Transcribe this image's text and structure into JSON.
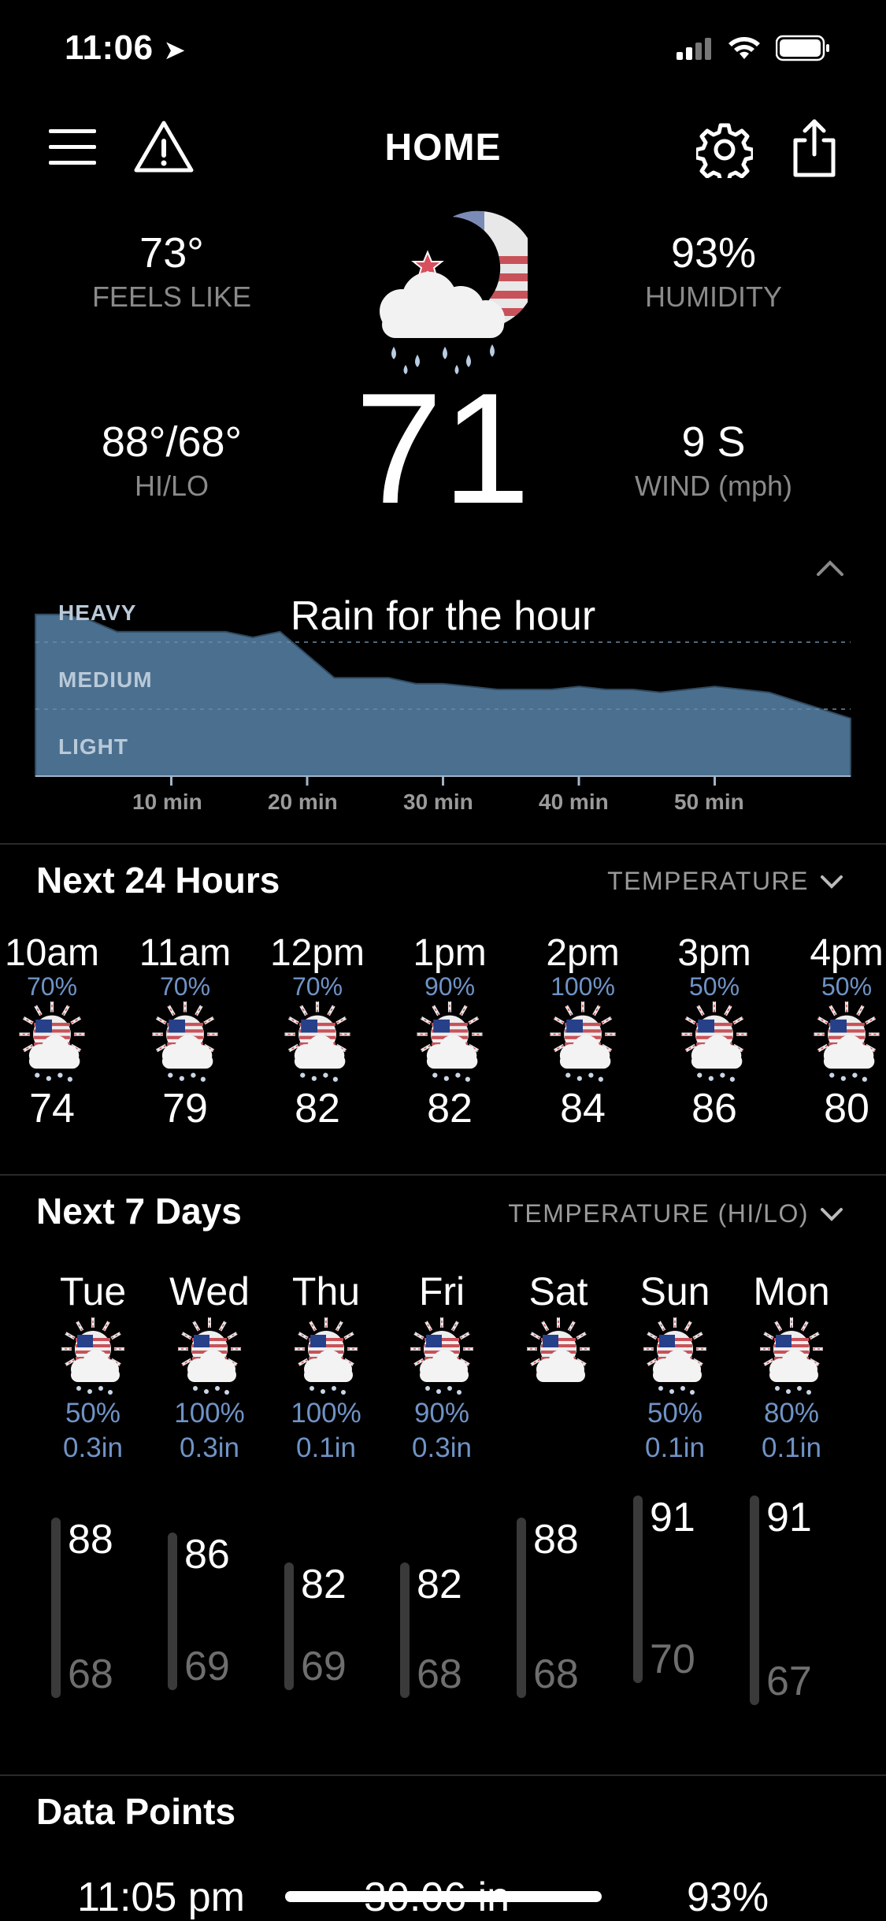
{
  "status": {
    "time": "11:06"
  },
  "nav": {
    "title": "HOME"
  },
  "current": {
    "feels_like": {
      "value": "73°",
      "label": "FEELS LIKE"
    },
    "humidity": {
      "value": "93%",
      "label": "HUMIDITY"
    },
    "hilo": {
      "value": "88°/68°",
      "label": "HI/LO"
    },
    "wind": {
      "value": "9 S",
      "label": "WIND (mph)"
    },
    "temperature": "71",
    "condition_icon": "moon-rain-cloud-icon"
  },
  "rain_chart": {
    "title": "Rain for the hour",
    "levels": [
      "HEAVY",
      "MEDIUM",
      "LIGHT"
    ],
    "ticks": [
      "10 min",
      "20 min",
      "30 min",
      "40 min",
      "50 min"
    ]
  },
  "chart_data": {
    "type": "area",
    "title": "Rain for the hour",
    "x": [
      0,
      2,
      4,
      6,
      8,
      10,
      12,
      14,
      16,
      18,
      20,
      22,
      24,
      26,
      28,
      30,
      32,
      34,
      36,
      38,
      40,
      42,
      44,
      46,
      48,
      50,
      52,
      54,
      56,
      58,
      60
    ],
    "y": [
      2.8,
      2.8,
      2.7,
      2.5,
      2.5,
      2.5,
      2.5,
      2.5,
      2.4,
      2.5,
      2.1,
      1.7,
      1.7,
      1.7,
      1.6,
      1.6,
      1.55,
      1.5,
      1.5,
      1.5,
      1.55,
      1.5,
      1.5,
      1.45,
      1.5,
      1.55,
      1.5,
      1.45,
      1.3,
      1.15,
      1.0
    ],
    "xlabel": "",
    "ylabel": "",
    "xticks": [
      "10 min",
      "20 min",
      "30 min",
      "40 min",
      "50 min"
    ],
    "ylevels": [
      "LIGHT",
      "MEDIUM",
      "HEAVY"
    ],
    "ylim": [
      0,
      3
    ]
  },
  "hourly": {
    "title": "Next 24 Hours",
    "selector": "TEMPERATURE",
    "items": [
      {
        "time": "10am",
        "precip": "70%",
        "temp": "74"
      },
      {
        "time": "11am",
        "precip": "70%",
        "temp": "79"
      },
      {
        "time": "12pm",
        "precip": "70%",
        "temp": "82"
      },
      {
        "time": "1pm",
        "precip": "90%",
        "temp": "82"
      },
      {
        "time": "2pm",
        "precip": "100%",
        "temp": "84"
      },
      {
        "time": "3pm",
        "precip": "50%",
        "temp": "86"
      },
      {
        "time": "4pm",
        "precip": "50%",
        "temp": "80"
      }
    ]
  },
  "daily": {
    "title": "Next 7 Days",
    "selector": "TEMPERATURE (HI/LO)",
    "items": [
      {
        "day": "Tue",
        "precip": "50%",
        "amount": "0.3in",
        "hi": "88",
        "lo": "68"
      },
      {
        "day": "Wed",
        "precip": "100%",
        "amount": "0.3in",
        "hi": "86",
        "lo": "69"
      },
      {
        "day": "Thu",
        "precip": "100%",
        "amount": "0.1in",
        "hi": "82",
        "lo": "69"
      },
      {
        "day": "Fri",
        "precip": "90%",
        "amount": "0.3in",
        "hi": "82",
        "lo": "68"
      },
      {
        "day": "Sat",
        "precip": "",
        "amount": "",
        "hi": "88",
        "lo": "68"
      },
      {
        "day": "Sun",
        "precip": "50%",
        "amount": "0.1in",
        "hi": "91",
        "lo": "70"
      },
      {
        "day": "Mon",
        "precip": "80%",
        "amount": "0.1in",
        "hi": "91",
        "lo": "67"
      }
    ]
  },
  "data_points": {
    "title": "Data Points",
    "row": {
      "time": "11:05 pm",
      "pressure": "30.06 in",
      "humidity": "93%"
    }
  },
  "colors": {
    "background": "#000000",
    "accent_blue": "#6f93c6",
    "rain_fill": "#4b6f8f"
  }
}
